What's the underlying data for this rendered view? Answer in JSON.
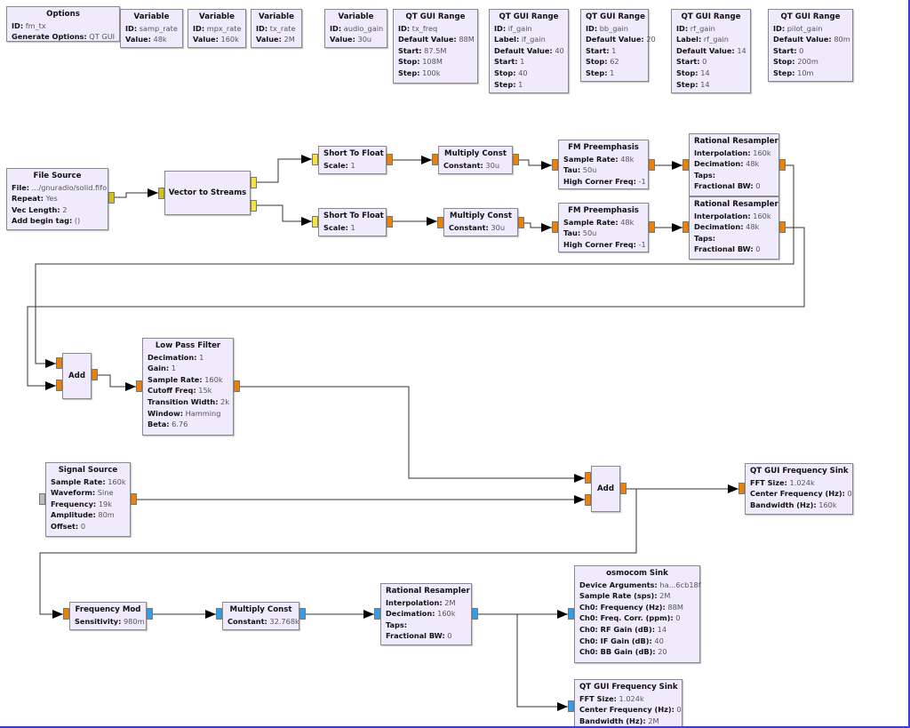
{
  "colors": {
    "block_bg": "#efebfd",
    "float_port": "#f08000",
    "short_port": "#f5e23c",
    "short_vector_port": "#d4c018",
    "complex_port": "#2b9ff0",
    "unconnected_port": "#bdbdbd",
    "wire": "#333333",
    "canvas_border": "#3a3adf"
  },
  "blocks": [
    {
      "name": "options-block",
      "title": "Options",
      "params": [
        {
          "k": "ID:",
          "v": "fm_tx"
        },
        {
          "k": "Generate Options:",
          "v": "QT GUI"
        }
      ]
    },
    {
      "name": "variable-samp-rate",
      "title": "Variable",
      "params": [
        {
          "k": "ID:",
          "v": "samp_rate"
        },
        {
          "k": "Value:",
          "v": "48k"
        }
      ]
    },
    {
      "name": "variable-mpx-rate",
      "title": "Variable",
      "params": [
        {
          "k": "ID:",
          "v": "mpx_rate"
        },
        {
          "k": "Value:",
          "v": "160k"
        }
      ]
    },
    {
      "name": "variable-tx-rate",
      "title": "Variable",
      "params": [
        {
          "k": "ID:",
          "v": "tx_rate"
        },
        {
          "k": "Value:",
          "v": "2M"
        }
      ]
    },
    {
      "name": "variable-audio-gain",
      "title": "Variable",
      "params": [
        {
          "k": "ID:",
          "v": "audio_gain"
        },
        {
          "k": "Value:",
          "v": "30u"
        }
      ]
    },
    {
      "name": "qt-gui-range-tx-freq",
      "title": "QT GUI Range",
      "params": [
        {
          "k": "ID:",
          "v": "tx_freq"
        },
        {
          "k": "Default Value:",
          "v": "88M"
        },
        {
          "k": "Start:",
          "v": "87.5M"
        },
        {
          "k": "Stop:",
          "v": "108M"
        },
        {
          "k": "Step:",
          "v": "100k"
        }
      ]
    },
    {
      "name": "qt-gui-range-if-gain",
      "title": "QT GUI Range",
      "params": [
        {
          "k": "ID:",
          "v": "if_gain"
        },
        {
          "k": "Label:",
          "v": "if_gain"
        },
        {
          "k": "Default Value:",
          "v": "40"
        },
        {
          "k": "Start:",
          "v": "1"
        },
        {
          "k": "Stop:",
          "v": "40"
        },
        {
          "k": "Step:",
          "v": "1"
        }
      ]
    },
    {
      "name": "qt-gui-range-bb-gain",
      "title": "QT GUI Range",
      "params": [
        {
          "k": "ID:",
          "v": "bb_gain"
        },
        {
          "k": "Default Value:",
          "v": "20"
        },
        {
          "k": "Start:",
          "v": "1"
        },
        {
          "k": "Stop:",
          "v": "62"
        },
        {
          "k": "Step:",
          "v": "1"
        }
      ]
    },
    {
      "name": "qt-gui-range-rf-gain",
      "title": "QT GUI Range",
      "params": [
        {
          "k": "ID:",
          "v": "rf_gain"
        },
        {
          "k": "Label:",
          "v": "rf_gain"
        },
        {
          "k": "Default Value:",
          "v": "14"
        },
        {
          "k": "Start:",
          "v": "0"
        },
        {
          "k": "Stop:",
          "v": "14"
        },
        {
          "k": "Step:",
          "v": "14"
        }
      ]
    },
    {
      "name": "qt-gui-range-pilot-gain",
      "title": "QT GUI Range",
      "params": [
        {
          "k": "ID:",
          "v": "pilot_gain"
        },
        {
          "k": "Default Value:",
          "v": "80m"
        },
        {
          "k": "Start:",
          "v": "0"
        },
        {
          "k": "Stop:",
          "v": "200m"
        },
        {
          "k": "Step:",
          "v": "10m"
        }
      ]
    },
    {
      "name": "file-source-block",
      "title": "File Source",
      "params": [
        {
          "k": "File:",
          "v": ".../gnuradio/solid.fifo"
        },
        {
          "k": "Repeat:",
          "v": "Yes"
        },
        {
          "k": "Vec Length:",
          "v": "2"
        },
        {
          "k": "Add begin tag:",
          "v": "()"
        }
      ]
    },
    {
      "name": "vector-to-streams-block",
      "title": "Vector to Streams",
      "params": []
    },
    {
      "name": "short-to-float-block-1",
      "title": "Short To Float",
      "params": [
        {
          "k": "Scale:",
          "v": "1"
        }
      ]
    },
    {
      "name": "short-to-float-block-2",
      "title": "Short To Float",
      "params": [
        {
          "k": "Scale:",
          "v": "1"
        }
      ]
    },
    {
      "name": "multiply-const-block-1",
      "title": "Multiply Const",
      "params": [
        {
          "k": "Constant:",
          "v": "30u"
        }
      ]
    },
    {
      "name": "multiply-const-block-2",
      "title": "Multiply Const",
      "params": [
        {
          "k": "Constant:",
          "v": "30u"
        }
      ]
    },
    {
      "name": "fm-preemphasis-block-1",
      "title": "FM Preemphasis",
      "params": [
        {
          "k": "Sample Rate:",
          "v": "48k"
        },
        {
          "k": "Tau:",
          "v": "50u"
        },
        {
          "k": "High Corner Freq:",
          "v": "-1"
        }
      ]
    },
    {
      "name": "fm-preemphasis-block-2",
      "title": "FM Preemphasis",
      "params": [
        {
          "k": "Sample Rate:",
          "v": "48k"
        },
        {
          "k": "Tau:",
          "v": "50u"
        },
        {
          "k": "High Corner Freq:",
          "v": "-1"
        }
      ]
    },
    {
      "name": "rational-resampler-block-1",
      "title": "Rational Resampler",
      "params": [
        {
          "k": "Interpolation:",
          "v": "160k"
        },
        {
          "k": "Decimation:",
          "v": "48k"
        },
        {
          "k": "Taps:",
          "v": ""
        },
        {
          "k": "Fractional BW:",
          "v": "0"
        }
      ]
    },
    {
      "name": "rational-resampler-block-2",
      "title": "Rational Resampler",
      "params": [
        {
          "k": "Interpolation:",
          "v": "160k"
        },
        {
          "k": "Decimation:",
          "v": "48k"
        },
        {
          "k": "Taps:",
          "v": ""
        },
        {
          "k": "Fractional BW:",
          "v": "0"
        }
      ]
    },
    {
      "name": "add-block-1",
      "title": "Add",
      "params": []
    },
    {
      "name": "low-pass-filter-block",
      "title": "Low Pass Filter",
      "params": [
        {
          "k": "Decimation:",
          "v": "1"
        },
        {
          "k": "Gain:",
          "v": "1"
        },
        {
          "k": "Sample Rate:",
          "v": "160k"
        },
        {
          "k": "Cutoff Freq:",
          "v": "15k"
        },
        {
          "k": "Transition Width:",
          "v": "2k"
        },
        {
          "k": "Window:",
          "v": "Hamming"
        },
        {
          "k": "Beta:",
          "v": "6.76"
        }
      ]
    },
    {
      "name": "signal-source-block",
      "title": "Signal Source",
      "params": [
        {
          "k": "Sample Rate:",
          "v": "160k"
        },
        {
          "k": "Waveform:",
          "v": "Sine"
        },
        {
          "k": "Frequency:",
          "v": "19k"
        },
        {
          "k": "Amplitude:",
          "v": "80m"
        },
        {
          "k": "Offset:",
          "v": "0"
        }
      ]
    },
    {
      "name": "add-block-2",
      "title": "Add",
      "params": []
    },
    {
      "name": "qt-gui-frequency-sink-block-1",
      "title": "QT GUI Frequency Sink",
      "params": [
        {
          "k": "FFT Size:",
          "v": "1.024k"
        },
        {
          "k": "Center Frequency (Hz):",
          "v": "0"
        },
        {
          "k": "Bandwidth (Hz):",
          "v": "160k"
        }
      ]
    },
    {
      "name": "frequency-mod-block",
      "title": "Frequency Mod",
      "params": [
        {
          "k": "Sensitivity:",
          "v": "980m"
        }
      ]
    },
    {
      "name": "multiply-const-block-3",
      "title": "Multiply Const",
      "params": [
        {
          "k": "Constant:",
          "v": "32.768k"
        }
      ]
    },
    {
      "name": "rational-resampler-block-3",
      "title": "Rational Resampler",
      "params": [
        {
          "k": "Interpolation:",
          "v": "2M"
        },
        {
          "k": "Decimation:",
          "v": "160k"
        },
        {
          "k": "Taps:",
          "v": ""
        },
        {
          "k": "Fractional BW:",
          "v": "0"
        }
      ]
    },
    {
      "name": "osmocom-sink-block",
      "title": "osmocom Sink",
      "params": [
        {
          "k": "Device Arguments:",
          "v": "ha...6cb18f"
        },
        {
          "k": "Sample Rate (sps):",
          "v": "2M"
        },
        {
          "k": "Ch0: Frequency (Hz):",
          "v": "88M"
        },
        {
          "k": "Ch0: Freq. Corr. (ppm):",
          "v": "0"
        },
        {
          "k": "Ch0: RF Gain (dB):",
          "v": "14"
        },
        {
          "k": "Ch0: IF Gain (dB):",
          "v": "40"
        },
        {
          "k": "Ch0: BB Gain (dB):",
          "v": "20"
        }
      ]
    },
    {
      "name": "qt-gui-frequency-sink-block-2",
      "title": "QT GUI Frequency Sink",
      "params": [
        {
          "k": "FFT Size:",
          "v": "1.024k"
        },
        {
          "k": "Center Frequency (Hz):",
          "v": "0"
        },
        {
          "k": "Bandwidth (Hz):",
          "v": "2M"
        }
      ]
    }
  ]
}
